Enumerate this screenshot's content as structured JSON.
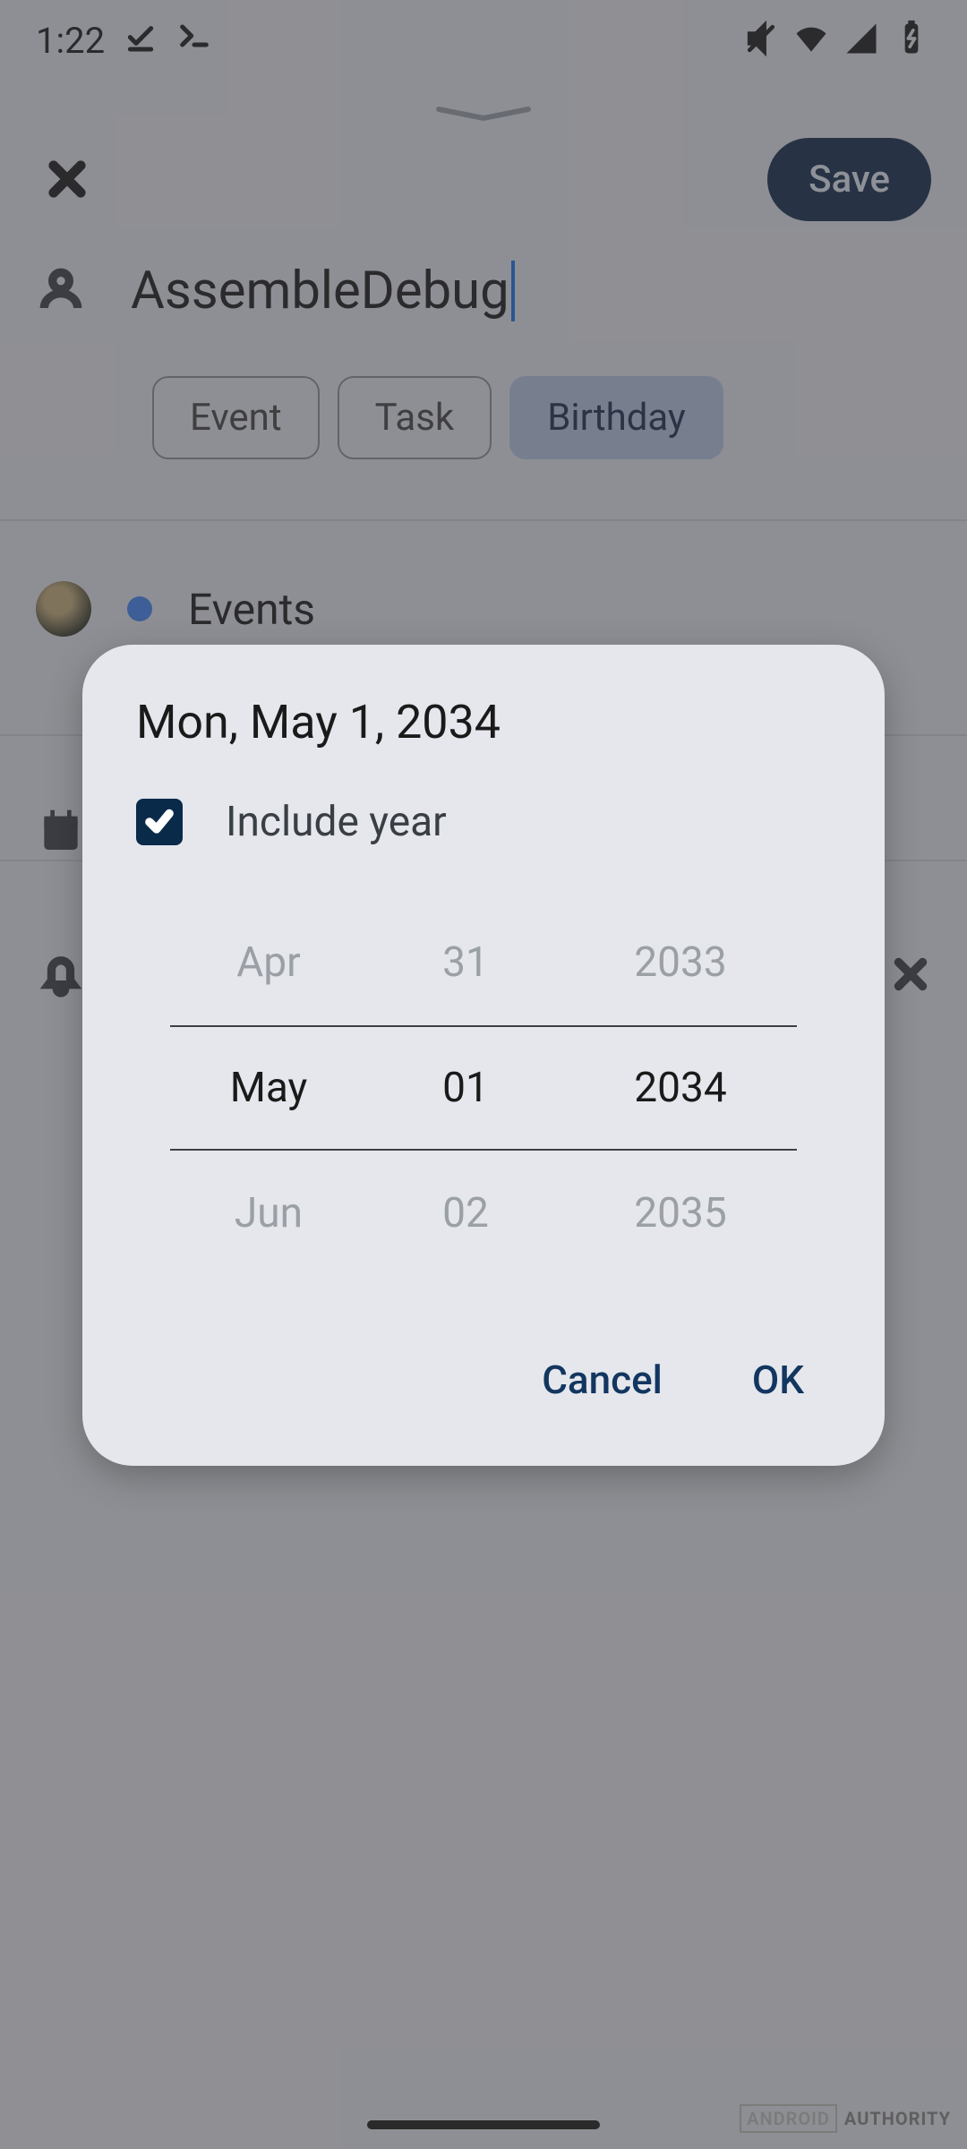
{
  "status": {
    "time": "1:22"
  },
  "header": {
    "save_label": "Save"
  },
  "title": "AssembleDebug",
  "chips": {
    "event": "Event",
    "task": "Task",
    "birthday": "Birthday"
  },
  "calendar": {
    "name": "Events"
  },
  "dialog": {
    "title": "Mon, May 1, 2034",
    "include_year_label": "Include year",
    "include_year_checked": true,
    "picker": {
      "month": {
        "prev": "Apr",
        "current": "May",
        "next": "Jun"
      },
      "day": {
        "prev": "31",
        "current": "01",
        "next": "02"
      },
      "year": {
        "prev": "2033",
        "current": "2034",
        "next": "2035"
      }
    },
    "cancel_label": "Cancel",
    "ok_label": "OK"
  },
  "watermark": {
    "box": "ANDROID",
    "brand": "AUTHORITY"
  }
}
